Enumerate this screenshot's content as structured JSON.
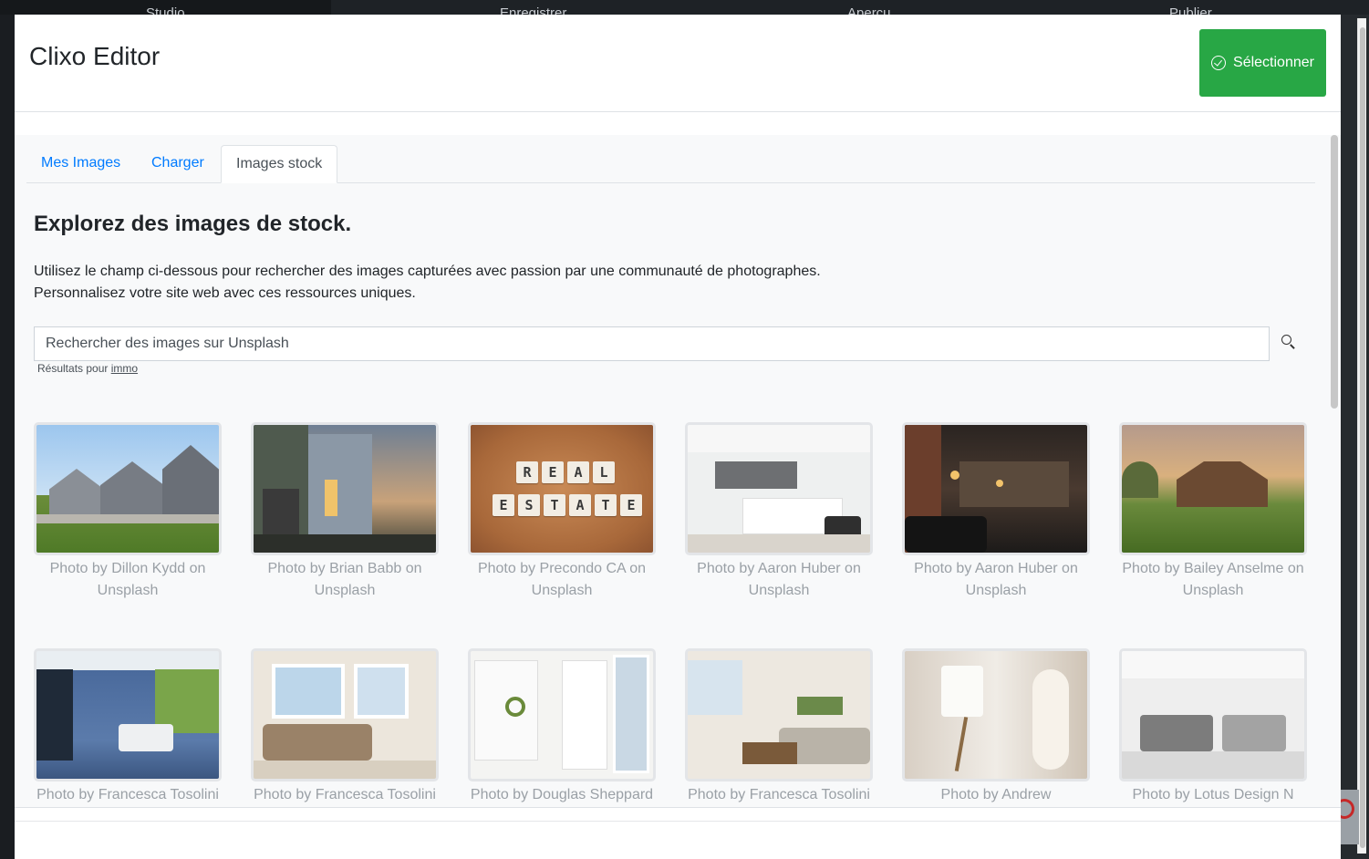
{
  "background": {
    "topbar_items": [
      "Studio",
      "Enregistrer",
      "Aperçu",
      "Publier"
    ]
  },
  "modal": {
    "title": "Clixo Editor",
    "select_button": "Sélectionner"
  },
  "tabs": [
    "Mes Images",
    "Charger",
    "Images stock"
  ],
  "active_tab": "Images stock",
  "stock": {
    "heading": "Explorez des images de stock.",
    "desc_line1": "Utilisez le champ ci-dessous pour rechercher des images capturées avec passion par une communauté de photographes.",
    "desc_line2": "Personnalisez votre site web avec ces ressources uniques.",
    "search_placeholder": "Rechercher des images sur Unsplash",
    "results_prefix": "Résultats pour",
    "results_query": "immo"
  },
  "photos": [
    {
      "caption_line1": "Photo by Dillon Kydd on",
      "caption_line2": "Unsplash"
    },
    {
      "caption_line1": "Photo by Brian Babb on",
      "caption_line2": "Unsplash"
    },
    {
      "caption_line1": "Photo by Precondo CA on",
      "caption_line2": "Unsplash"
    },
    {
      "caption_line1": "Photo by Aaron Huber on",
      "caption_line2": "Unsplash"
    },
    {
      "caption_line1": "Photo by Aaron Huber on",
      "caption_line2": "Unsplash"
    },
    {
      "caption_line1": "Photo by Bailey Anselme on",
      "caption_line2": "Unsplash"
    },
    {
      "caption_line1": "Photo by Francesca Tosolini",
      "caption_line2": ""
    },
    {
      "caption_line1": "Photo by Francesca Tosolini",
      "caption_line2": ""
    },
    {
      "caption_line1": "Photo by Douglas Sheppard",
      "caption_line2": ""
    },
    {
      "caption_line1": "Photo by Francesca Tosolini",
      "caption_line2": ""
    },
    {
      "caption_line1": "Photo by Andrew",
      "caption_line2": ""
    },
    {
      "caption_line1": "Photo by Lotus Design N",
      "caption_line2": ""
    }
  ],
  "real_estate_tiles": {
    "row1": [
      "R",
      "E",
      "A",
      "L"
    ],
    "row2": [
      "E",
      "S",
      "T",
      "A",
      "T",
      "E"
    ]
  },
  "colors": {
    "accent": "#007bff",
    "success": "#28a745",
    "caption": "#9aa0a6"
  }
}
